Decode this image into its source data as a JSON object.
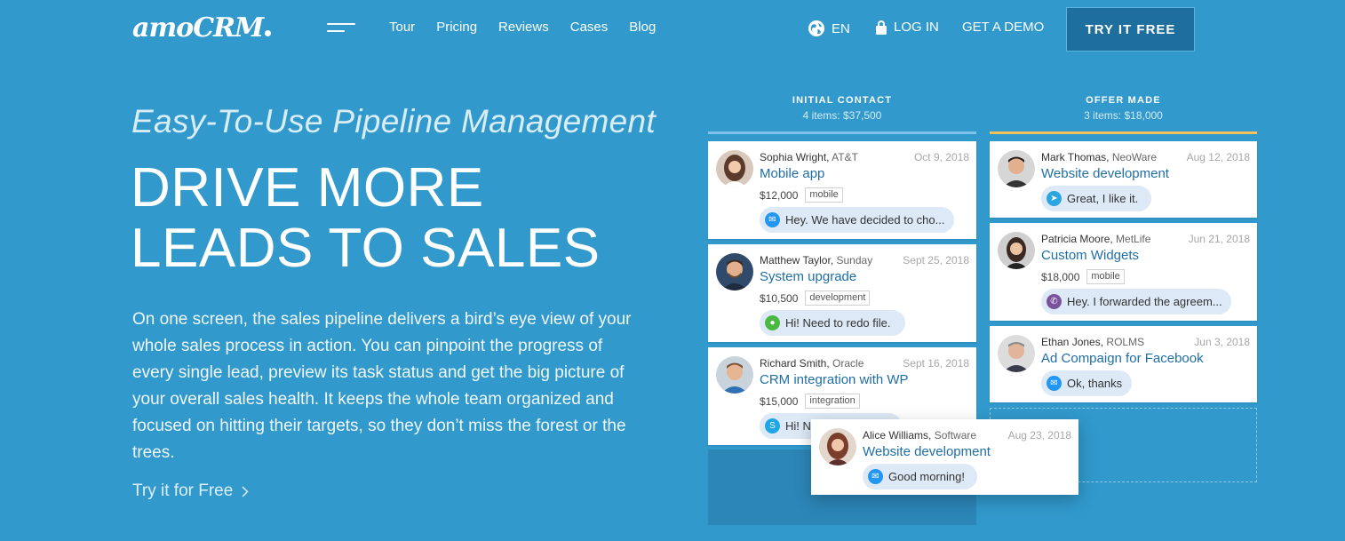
{
  "nav": {
    "logo": "amoCRM",
    "links": [
      "Tour",
      "Pricing",
      "Reviews",
      "Cases",
      "Blog"
    ],
    "lang": "EN",
    "login": "LOG IN",
    "demo": "GET A DEMO",
    "try_free": "TRY IT FREE"
  },
  "hero": {
    "subtitle": "Easy-To-Use Pipeline Management",
    "headline_line1": "DRIVE MORE",
    "headline_line2": "LEADS TO SALES",
    "body": "On one screen, the sales pipeline delivers a bird’s eye view of your whole sales process in action. You can pinpoint the progress of every single lead, preview its task status and get the big picture of your overall sales health. It keeps the whole team organized and focused on hitting their targets, so they don’t miss the forest or the trees.",
    "cta": "Try it for Free"
  },
  "pipeline": {
    "columns": [
      {
        "title": "INITIAL CONTACT",
        "summary": "4 items: $37,500",
        "color": "#7fc1ec"
      },
      {
        "title": "OFFER MADE",
        "summary": "3 items: $18,000",
        "color": "#f5c35c"
      }
    ],
    "cards": [
      {
        "name": "Sophia Wright,",
        "company": "AT&T",
        "date": "Oct 9, 2018",
        "deal": "Mobile app",
        "price": "$12,000",
        "tag": "mobile",
        "message": "Hey. We have decided to cho...",
        "icon": "messenger-icon",
        "icon_color": "#2196f3"
      },
      {
        "name": "Matthew Taylor,",
        "company": "Sunday",
        "date": "Sept 25, 2018",
        "deal": "System upgrade",
        "price": "$10,500",
        "tag": "development",
        "message": "Hi! Need to redo file.",
        "icon": "wechat-icon",
        "icon_color": "#4cb844"
      },
      {
        "name": "Richard Smith,",
        "company": "Oracle",
        "date": "Sept 16, 2018",
        "deal": "CRM integration with WP",
        "price": "$15,000",
        "tag": "integration",
        "message": "Hi! N",
        "icon": "skype-icon",
        "icon_color": "#1fa6e6"
      },
      {
        "name": "Mark Thomas,",
        "company": "NeoWare",
        "date": "Aug 12, 2018",
        "deal": "Website development",
        "message": "Great, I like it.",
        "icon": "telegram-icon",
        "icon_color": "#2ca5e0"
      },
      {
        "name": "Patricia Moore,",
        "company": "MetLife",
        "date": "Jun 21, 2018",
        "deal": "Custom Widgets",
        "price": "$18,000",
        "tag": "mobile",
        "message": "Hey. I forwarded the agreem...",
        "icon": "viber-icon",
        "icon_color": "#7b519d"
      },
      {
        "name": "Ethan Jones,",
        "company": "ROLMS",
        "date": "Jun 3, 2018",
        "deal": "Ad Compaign for Facebook",
        "message": "Ok, thanks",
        "icon": "messenger-icon",
        "icon_color": "#2196f3"
      },
      {
        "name": "Alice Williams,",
        "company": "Software",
        "date": "Aug 23, 2018",
        "deal": "Website development",
        "message": "Good morning!",
        "icon": "messenger-icon",
        "icon_color": "#2196f3"
      }
    ]
  }
}
